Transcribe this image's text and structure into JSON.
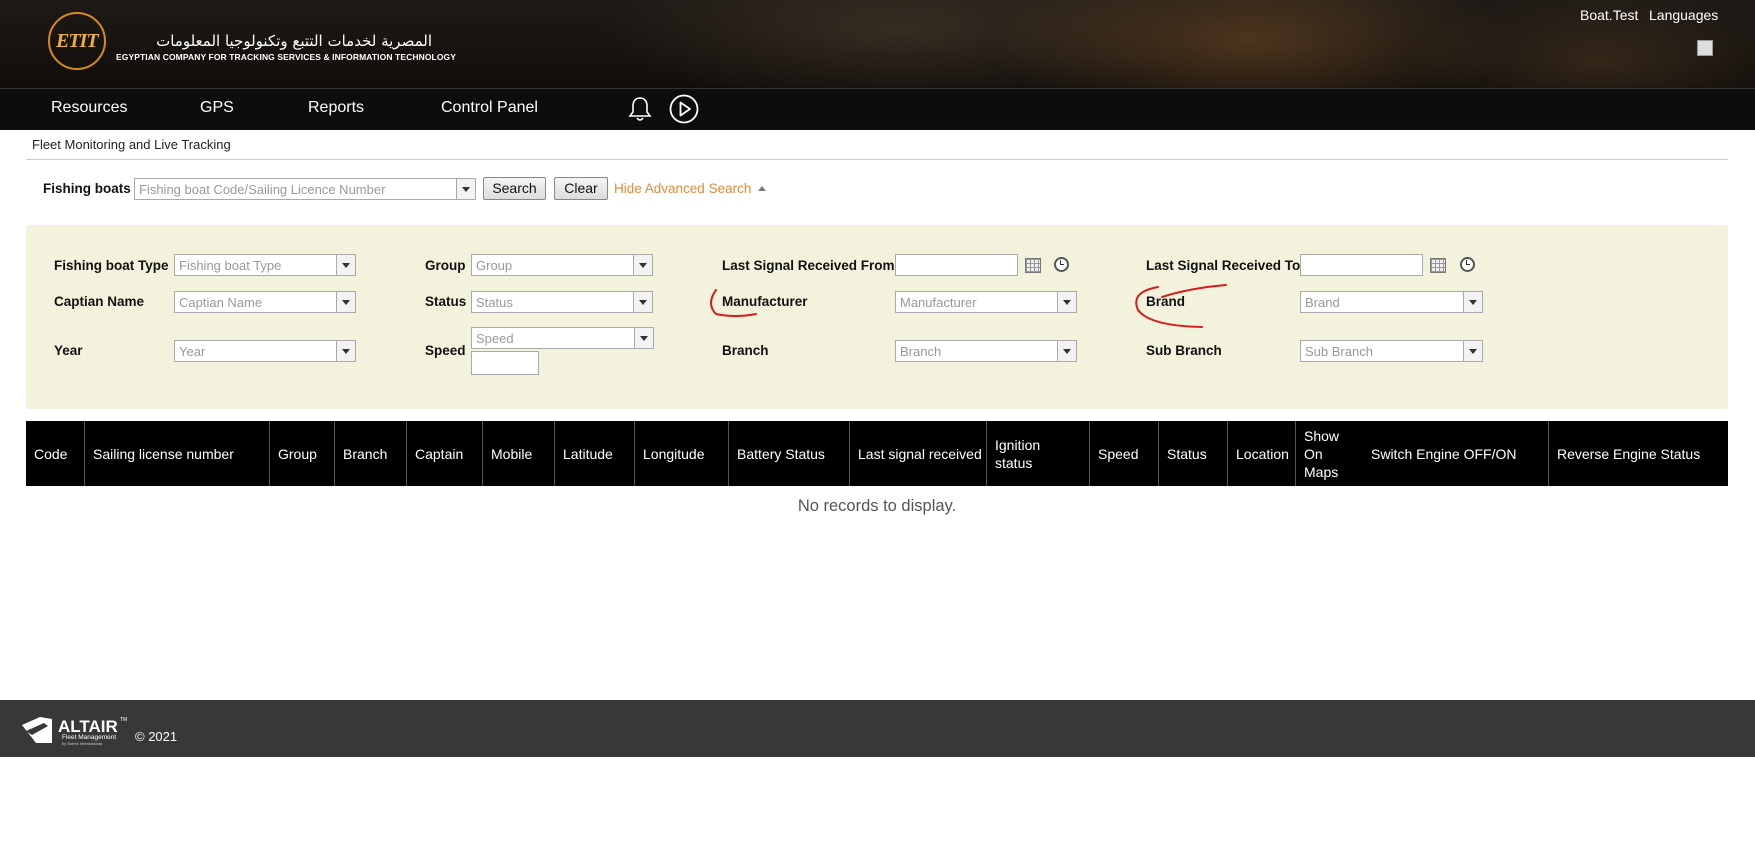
{
  "header": {
    "logo_mark": "ETIT",
    "company_arabic": "المصرية لخدمات التتبع وتكنولوجيا المعلومات",
    "company_english": "EGYPTIAN COMPANY FOR TRACKING SERVICES & INFORMATION TECHNOLOGY",
    "user": "Boat.Test",
    "languages": "Languages"
  },
  "nav": {
    "items": [
      "Resources",
      "GPS",
      "Reports",
      "Control Panel"
    ],
    "icons": [
      "bell-icon",
      "play-circle-icon"
    ]
  },
  "page_title": "Fleet Monitoring and Live Tracking",
  "search": {
    "label": "Fishing boats",
    "placeholder": "Fishing boat Code/Sailing Licence Number",
    "search_button": "Search",
    "clear_button": "Clear",
    "toggle_link": "Hide Advanced Search"
  },
  "advanced": {
    "fishing_boat_type": {
      "label": "Fishing boat Type",
      "placeholder": "Fishing boat Type"
    },
    "captain_name": {
      "label": "Captian Name",
      "placeholder": "Captian Name"
    },
    "year": {
      "label": "Year",
      "placeholder": "Year"
    },
    "group": {
      "label": "Group",
      "placeholder": "Group"
    },
    "status": {
      "label": "Status",
      "placeholder": "Status"
    },
    "speed": {
      "label": "Speed",
      "placeholder": "Speed"
    },
    "last_signal_from": {
      "label": "Last Signal Received From",
      "value": ""
    },
    "manufacturer": {
      "label": "Manufacturer",
      "placeholder": "Manufacturer"
    },
    "branch": {
      "label": "Branch",
      "placeholder": "Branch"
    },
    "last_signal_to": {
      "label": "Last Signal Received To",
      "value": ""
    },
    "brand": {
      "label": "Brand",
      "placeholder": "Brand"
    },
    "sub_branch": {
      "label": "Sub Branch",
      "placeholder": "Sub Branch"
    }
  },
  "grid": {
    "columns": [
      "Code",
      "Sailing license number",
      "Group",
      "Branch",
      "Captain",
      "Mobile",
      "Latitude",
      "Longitude",
      "Battery Status",
      "Last signal received",
      "Ignition status",
      "Speed",
      "Status",
      "Location",
      "Show On Maps",
      "Switch Engine OFF/ON",
      "Reverse Engine Status"
    ],
    "empty_message": "No records to display."
  },
  "footer": {
    "logo_name": "ALTAIR",
    "logo_tm": "TM",
    "logo_subtitle": "Fleet Management",
    "logo_byline": "by Sofrec International",
    "copyright": "© 2021"
  },
  "colors": {
    "nav_bg": "#0d0d0d",
    "advanced_bg": "#f3f2dc",
    "link_orange": "#e28b3a",
    "footer_bg": "#383838",
    "annotation_red": "#d81b1b"
  }
}
